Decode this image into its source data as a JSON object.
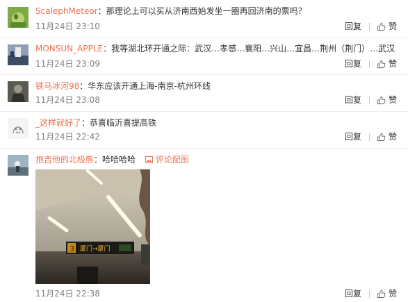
{
  "comments": [
    {
      "username": "ScalephMeteor",
      "separator": "：",
      "content": "那理论上可以买从济南西始发坐一圈再回济南的票吗？",
      "time": "11月24日 23:10",
      "reply_label": "回复",
      "like_label": "赞"
    },
    {
      "username": "MONSUN_APPLE",
      "separator": "：",
      "content": "我等湖北环开通之际：武汉…孝感…襄阳…兴山…宜昌…荆州（荆门）…武汉",
      "time": "11月24日 23:09",
      "reply_label": "回复",
      "like_label": "赞"
    },
    {
      "username": "铁马冰河98",
      "separator": "：",
      "content": "华东应该开通上海-南京-杭州环线",
      "time": "11月24日 23:08",
      "reply_label": "回复",
      "like_label": "赞"
    },
    {
      "username": "_这样就好了",
      "separator": "：",
      "content": "恭喜临沂喜提高铁",
      "time": "11月24日 22:42",
      "reply_label": "回复",
      "like_label": "赞"
    },
    {
      "username": "抱吉他的北极熊",
      "separator": "：",
      "content": "哈哈哈哈",
      "pic_link": "评论配图",
      "time": "11月24日 22:38",
      "reply_label": "回复",
      "like_label": "赞"
    }
  ],
  "photo": {
    "sign_text": "厦门→厦门",
    "sign_number": "3"
  },
  "icons": {
    "like": "thumbs-up-icon",
    "picture": "picture-icon"
  },
  "colors": {
    "username": "#eb7350",
    "text": "#333333",
    "time": "#808080",
    "divider": "#ececec"
  }
}
